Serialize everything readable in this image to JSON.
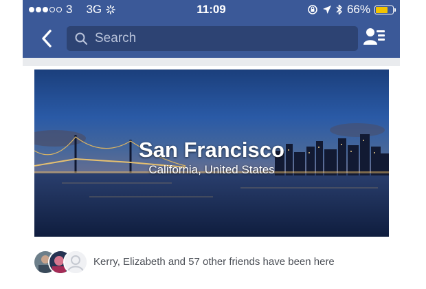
{
  "status_bar": {
    "carrier": "3",
    "network": "3G",
    "time": "11:09",
    "battery_percent": "66%",
    "battery_level": 0.66,
    "signal_dots_filled": 3,
    "signal_dots_total": 5
  },
  "navbar": {
    "search_placeholder": "Search",
    "bar_color": "#3b5998"
  },
  "place": {
    "name": "San Francisco",
    "location": "California, United States"
  },
  "friends": {
    "text": "Kerry, Elizabeth and 57 other friends have been here"
  },
  "colors": {
    "accent": "#3b5998",
    "battery": "#f3c400"
  }
}
